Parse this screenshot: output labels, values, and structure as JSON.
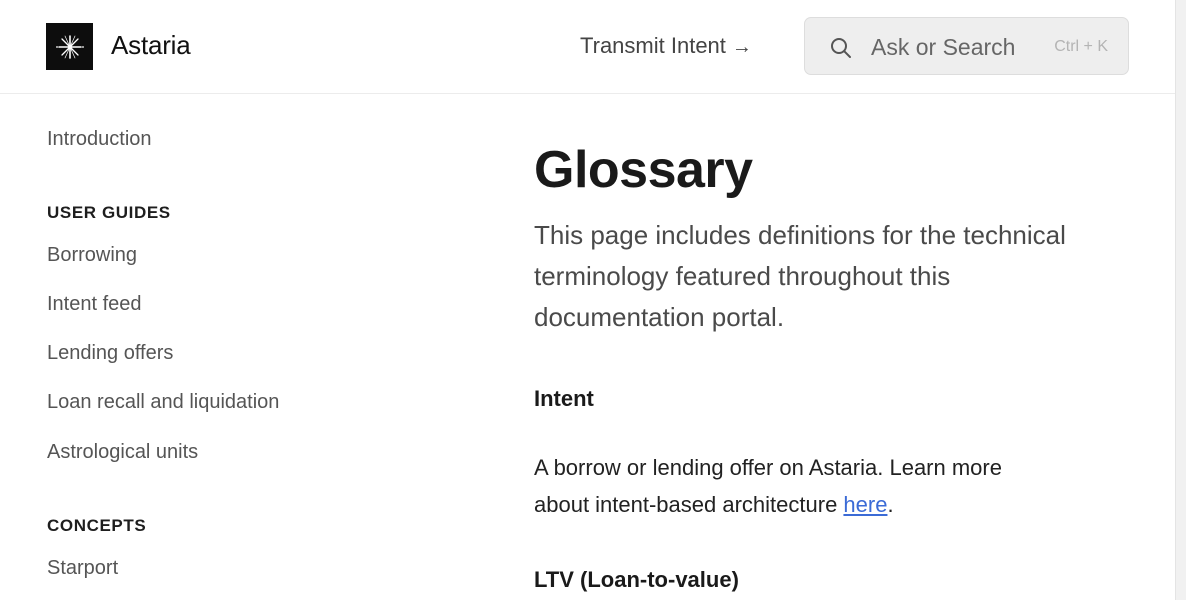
{
  "header": {
    "brand": "Astaria",
    "logo_icon": "starburst-icon",
    "transmit_label": "Transmit Intent",
    "transmit_arrow": "→",
    "search": {
      "placeholder": "Ask or Search",
      "shortcut": "Ctrl + K",
      "icon": "search-icon"
    }
  },
  "sidebar": {
    "intro": "Introduction",
    "sections": [
      {
        "title": "USER GUIDES",
        "items": [
          "Borrowing",
          "Intent feed",
          "Lending offers",
          "Loan recall and liquidation",
          "Astrological units"
        ]
      },
      {
        "title": "CONCEPTS",
        "items": [
          "Starport"
        ]
      }
    ]
  },
  "main": {
    "title": "Glossary",
    "lead": "This page includes definitions for the technical terminology featured throughout this documentation portal.",
    "entries": [
      {
        "term": "Intent",
        "definition_before_link": "A borrow or lending offer on Astaria. Learn more about intent-based architecture ",
        "link_text": "here",
        "definition_after_link": "."
      },
      {
        "term": "LTV (Loan-to-value)"
      }
    ]
  },
  "colors": {
    "link": "#3b6bd6",
    "logo_bg": "#0d0d0d",
    "search_bg": "#eeeeee"
  }
}
